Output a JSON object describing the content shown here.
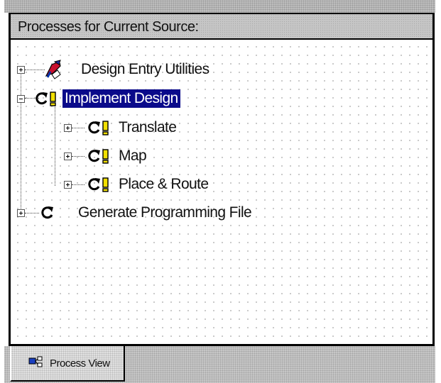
{
  "panel": {
    "title": "Processes for Current Source:"
  },
  "tree": {
    "items": [
      {
        "label": "Design Entry Utilities",
        "expander": "plus",
        "icons": [
          "tools-icon"
        ]
      },
      {
        "label": "Implement Design",
        "expander": "minus",
        "icons": [
          "refresh-icon",
          "warning-icon"
        ],
        "selected": true
      },
      {
        "label": "Translate",
        "expander": "plus",
        "icons": [
          "refresh-icon",
          "warning-icon"
        ]
      },
      {
        "label": "Map",
        "expander": "plus",
        "icons": [
          "refresh-icon",
          "warning-icon"
        ]
      },
      {
        "label": "Place & Route",
        "expander": "plus",
        "icons": [
          "refresh-icon",
          "warning-icon"
        ]
      },
      {
        "label": "Generate Programming File",
        "expander": "plus",
        "icons": [
          "refresh-icon"
        ]
      }
    ]
  },
  "tabs": [
    {
      "label": "Process View",
      "icon": "process-view-icon",
      "active": true
    }
  ],
  "colors": {
    "selection_bg": "#0a0a8a",
    "warning": "#f2e000"
  }
}
